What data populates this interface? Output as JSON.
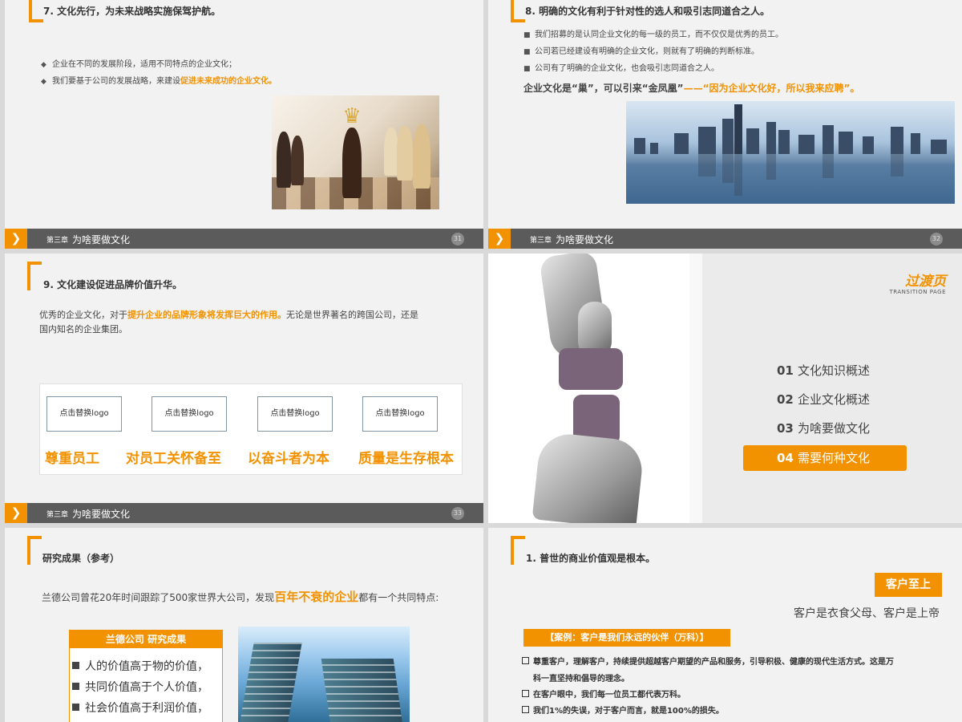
{
  "footer": {
    "chapter_label": "第三章",
    "chapter_title": "为啥要做文化",
    "arrow_glyph": "❯"
  },
  "slide31": {
    "title": "7. 文化先行，为未来战略实施保驾护航。",
    "bullet_mark": "◆",
    "bullets": [
      {
        "text": "企业在不同的发展阶段，适用不同特点的企业文化；",
        "highlight": ""
      },
      {
        "text": "我们要基于公司的发展战略，来建设",
        "highlight": "促进未来成功的企业文化。"
      }
    ],
    "page": "31"
  },
  "slide32": {
    "title": "8. 明确的文化有利于针对性的选人和吸引志同道合之人。",
    "bullet_mark": "■",
    "bullets": [
      "我们招募的是认同企业文化的每一级的员工，而不仅仅是优秀的员工。",
      "公司若已经建设有明确的企业文化，则就有了明确的判断标准。",
      "公司有了明确的企业文化，也会吸引志同道合之人。"
    ],
    "quote_plain": "企业文化是“巢”，可以引来“金凤凰”",
    "quote_highlight": "——“因为企业文化好，所以我来应聘”。",
    "page": "32"
  },
  "slide33": {
    "title": "9. 文化建设促进品牌价值升华。",
    "para_plain_1": "优秀的企业文化，对于",
    "para_highlight": "提升企业的品牌形象将发挥巨大的作用。",
    "para_plain_2": "无论是世界著名的跨国公司，还是",
    "para_line2": "国内知名的企业集团。",
    "logos": [
      "点击替换logo",
      "点击替换logo",
      "点击替换logo",
      "点击替换logo"
    ],
    "values": [
      "尊重员工",
      "对员工关怀备至",
      "以奋斗者为本",
      "质量是生存根本"
    ],
    "page": "33"
  },
  "slide34": {
    "title": "过渡页",
    "subtitle": "TRANSITION PAGE",
    "menu": [
      {
        "num": "01",
        "label": "文化知识概述",
        "active": false
      },
      {
        "num": "02",
        "label": "企业文化概述",
        "active": false
      },
      {
        "num": "03",
        "label": "为啥要做文化",
        "active": false
      },
      {
        "num": "04",
        "label": "需要何种文化",
        "active": true
      }
    ]
  },
  "slide35": {
    "title": "研究成果（参考）",
    "intro_plain": "兰德公司曾花20年时间跟踪了500家世界大公司，发现",
    "intro_highlight": "百年不衰的企业",
    "intro_tail": "都有一个共同特点:",
    "box_title": "兰德公司 研究成果",
    "items": [
      "人的价值高于物的价值，",
      "共同价值高于个人价值，",
      "社会价值高于利润价值，"
    ]
  },
  "slide36": {
    "title": "1. 普世的商业价值观是根本。",
    "tag": "客户至上",
    "tag_sub": "客户是衣食父母、客户是上帝",
    "case_label": "【案例：客户是我们永远的伙伴（万科）】",
    "lines": [
      "尊重客户，理解客户，持续提供超越客户期望的产品和服务，引导积极、健康的现代生活方式。这是万",
      "科一直坚持和倡导的理念。",
      "在客户眼中，我们每一位员工都代表万科。",
      "我们1%的失误，对于客户而言，就是100%的损失。"
    ]
  },
  "colors": {
    "accent": "#f39200",
    "footer": "#5b5b5b"
  }
}
